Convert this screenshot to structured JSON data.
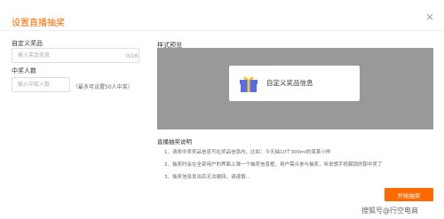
{
  "dialog": {
    "title": "设置直播抽奖",
    "close": "×"
  },
  "form": {
    "prize_label": "自定义奖品",
    "prize_placeholder": "输入奖品信息",
    "prize_counter": "0/16",
    "winners_label": "中奖人数",
    "winners_placeholder": "输入中奖人数",
    "winners_hint": "（最多可设置50人中奖）"
  },
  "preview": {
    "title": "样式预览",
    "card_text": "自定义奖品信息"
  },
  "instructions": {
    "title": "直播抽奖说明",
    "items": [
      "1、请将中奖奖品信息写在奖品信息内，比如：今天抽10个300ml的某某小样",
      "2、抽奖时会在全部用户的界面上弹一个抽奖信息框，用户需点参与抽奖，听说想手机解锁的那中奖了",
      "3、抽奖信息发出后无法撤回，请谨慎..."
    ]
  },
  "footer": {
    "start_button": "开始抽奖",
    "watermark": "搜狐号@行空电商"
  },
  "colors": {
    "accent": "#ff6a00",
    "preview_bg": "#999999",
    "gift_body": "#5b6ee1",
    "gift_ribbon": "#f5c342"
  }
}
